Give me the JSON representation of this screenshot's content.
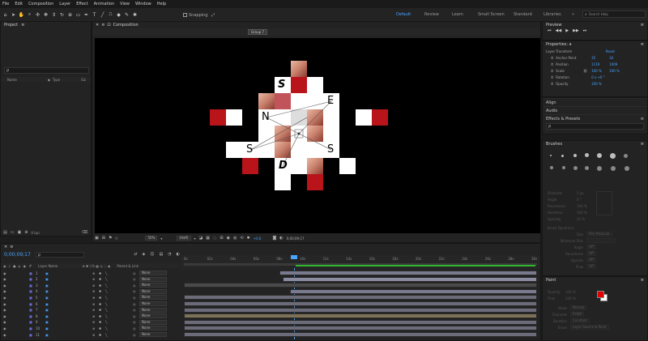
{
  "menu": [
    "File",
    "Edit",
    "Composition",
    "Layer",
    "Effect",
    "Animation",
    "View",
    "Window",
    "Help"
  ],
  "toolbar": {
    "snapping_label": "Snapping",
    "workspaces": [
      "Default",
      "Review",
      "Learn",
      "Small Screen",
      "Standard",
      "Libraries"
    ],
    "active_workspace": "Default",
    "search_placeholder": "Search Help",
    "more": "»"
  },
  "project": {
    "title": "Project",
    "search_placeholder": "ρ",
    "columns": [
      "Name",
      "Type",
      "Siz"
    ],
    "footer_bpc": "8 bpc"
  },
  "composition": {
    "title": "Composition",
    "tab": "Group 7",
    "zoom": "50%",
    "resolution": "(Half)",
    "exposure": "+0.0",
    "timecode": "0;00;09;17"
  },
  "artwork": {
    "letters": [
      "S",
      "E",
      "N",
      "S",
      "S",
      "D"
    ]
  },
  "preview": {
    "title": "Preview",
    "controls": [
      "first-icon",
      "prev-icon",
      "play-icon",
      "next-icon",
      "last-icon"
    ]
  },
  "properties": {
    "title": "Properties: a",
    "section": "Layer Transform",
    "reset": "Reset",
    "rows": [
      {
        "label": "Anchor Point",
        "v1": "35",
        "v2": "34"
      },
      {
        "label": "Position",
        "v1": "1119",
        "v2": "1009"
      },
      {
        "label": "Scale",
        "v1": "100 %",
        "v2": "100 %"
      },
      {
        "label": "Rotation",
        "v1": "0 x +0 °",
        "v2": ""
      },
      {
        "label": "Opacity",
        "v1": "100 %",
        "v2": ""
      }
    ]
  },
  "sections": {
    "align": "Align",
    "audio": "Audio",
    "effects": "Effects & Presets",
    "effects_search": "ρ",
    "brushes": "Brushes",
    "paint": "Paint"
  },
  "brushes_props": [
    {
      "label": "Diameter",
      "value": "5 px"
    },
    {
      "label": "Angle",
      "value": "0 °"
    },
    {
      "label": "Roundness",
      "value": "100 %"
    },
    {
      "label": "Hardness",
      "value": "100 %"
    },
    {
      "label": "Spacing",
      "value": "25 %"
    }
  ],
  "brush_dynamics": {
    "title": "Brush Dynamics",
    "rows": [
      "Size",
      "Minimum Size",
      "Angle",
      "Roundness",
      "Opacity",
      "Flow"
    ],
    "pen_value": "Pen Pressure",
    "off_value": "Off"
  },
  "paint": {
    "opacity_label": "Opacity",
    "opacity_value": "100 %",
    "flow_label": "Flow",
    "flow_value": "100 %",
    "mode_label": "Mode",
    "mode_value": "Normal",
    "channels_label": "Channels",
    "channels_value": "RGBA",
    "duration_label": "Duration",
    "duration_value": "Constant",
    "erase_label": "Erase",
    "erase_value": "Layer Source & Paint",
    "primary_color": "#e00000",
    "secondary_color": "#ffffff"
  },
  "timeline": {
    "timecode": "0;00;09;17",
    "search_placeholder": "ρ",
    "layer_header": "Layer Name",
    "parent_header": "Parent & Link",
    "ruler": [
      "0s",
      "02s",
      "04s",
      "06s",
      "08s",
      "10s",
      "12s",
      "14s",
      "16s",
      "18s",
      "20s",
      "22s",
      "24s",
      "26s",
      "28s",
      "30s"
    ],
    "layers": [
      {
        "num": "1",
        "parent": "None"
      },
      {
        "num": "2",
        "parent": "None"
      },
      {
        "num": "3",
        "parent": "None"
      },
      {
        "num": "4",
        "parent": "None"
      },
      {
        "num": "5",
        "parent": "None"
      },
      {
        "num": "6",
        "parent": "None"
      },
      {
        "num": "7",
        "parent": "None"
      },
      {
        "num": "8",
        "parent": "None"
      },
      {
        "num": "9",
        "parent": "None"
      },
      {
        "num": "10",
        "parent": "None"
      },
      {
        "num": "11",
        "parent": "None"
      }
    ]
  }
}
